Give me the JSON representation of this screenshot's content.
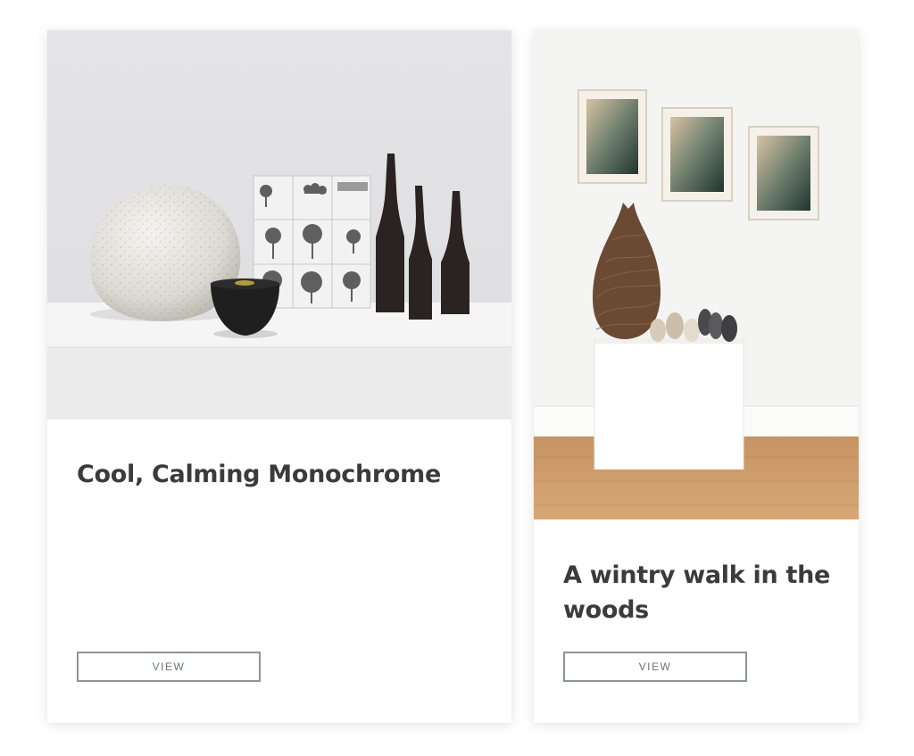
{
  "cards": [
    {
      "image_alt": "Monochrome still life: white textured sphere, black bowl, tree photograph panel and dark bottle sculptures on a white shelf",
      "title": "Cool, Calming Monochrome",
      "button_label": "VIEW"
    },
    {
      "image_alt": "Gallery wall with three framed prints above a plinth holding a twig vessel and small ceramic pots",
      "title": "A wintry walk in the woods",
      "button_label": "VIEW"
    }
  ],
  "colors": {
    "title_text": "#3b3b3b",
    "button_border": "#8a949d",
    "button_text": "#6b747b",
    "card_background": "#ffffff"
  }
}
